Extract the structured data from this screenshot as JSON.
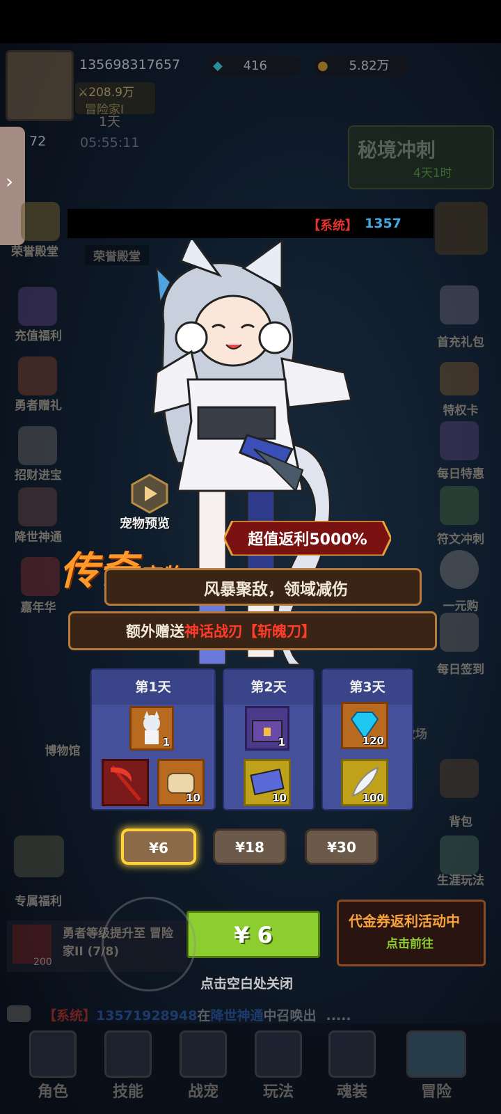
{
  "player": {
    "id": "135698317657",
    "power": "208.9万",
    "rank": "冒险家I",
    "days": "1天",
    "level": "72",
    "timer": "05:55:11"
  },
  "resources": {
    "diamonds": "416",
    "gold": "5.82万"
  },
  "event_banner": {
    "title": "秘境冲刺",
    "remaining": "4天1时"
  },
  "left_menu": [
    "荣誉殿堂",
    "充值福利",
    "勇者赠礼",
    "招财进宝",
    "降世神通",
    "嘉年华",
    "博物馆",
    "专属福利"
  ],
  "right_menu": [
    "首充礼包",
    "特权卡",
    "每日特惠",
    "符文冲刺",
    "一元购",
    "每日签到",
    "牧场",
    "背包",
    "生涯玩法"
  ],
  "map_labels": {
    "hall": "荣誉殿堂"
  },
  "system_bar": {
    "tag": "【系统】",
    "value": "1357"
  },
  "popup": {
    "preview_label": "宠物预览",
    "rebate": "超值返利5000%",
    "title_big": "传奇",
    "title_small": "宠物",
    "skill": "风暴聚敌，领域减伤",
    "bonus_prefix": "额外赠送",
    "bonus_item": "神话战刃【斩魄刀】",
    "days": [
      {
        "label": "第1天",
        "items": [
          {
            "icon": "pet-cat-girl-icon",
            "qty": "1"
          },
          {
            "icon": "red-scythe-icon",
            "qty": ""
          },
          {
            "icon": "bread-icon",
            "qty": "10"
          }
        ]
      },
      {
        "label": "第2天",
        "items": [
          {
            "icon": "treasure-chest-icon",
            "qty": "1"
          },
          {
            "icon": "ticket-icon",
            "qty": "10"
          }
        ]
      },
      {
        "label": "第3天",
        "items": [
          {
            "icon": "diamond-icon",
            "qty": "120"
          },
          {
            "icon": "feather-icon",
            "qty": "100"
          }
        ]
      }
    ],
    "prices": [
      "¥6",
      "¥18",
      "¥30"
    ],
    "buy_label": "¥ 6",
    "close_hint": "点击空白处关闭",
    "voucher_title": "代金券返利活动中",
    "voucher_action": "点击前往"
  },
  "quest": {
    "text": "勇者等级提升至 冒险家II (7/8)",
    "reward": "200"
  },
  "chat": {
    "tag": "【系统】",
    "player": "13571928948",
    "mid": "在",
    "place": "降世神通",
    "tail": "中召唤出",
    "dots": "....."
  },
  "bottom_nav": [
    "角色",
    "技能",
    "战宠",
    "玩法",
    "魂装",
    "冒险"
  ],
  "colors": {
    "accent_green": "#8ccd2f",
    "sys_red": "#e0342c",
    "sys_blue": "#3fa9e6",
    "gold_text": "#f7a23a"
  }
}
